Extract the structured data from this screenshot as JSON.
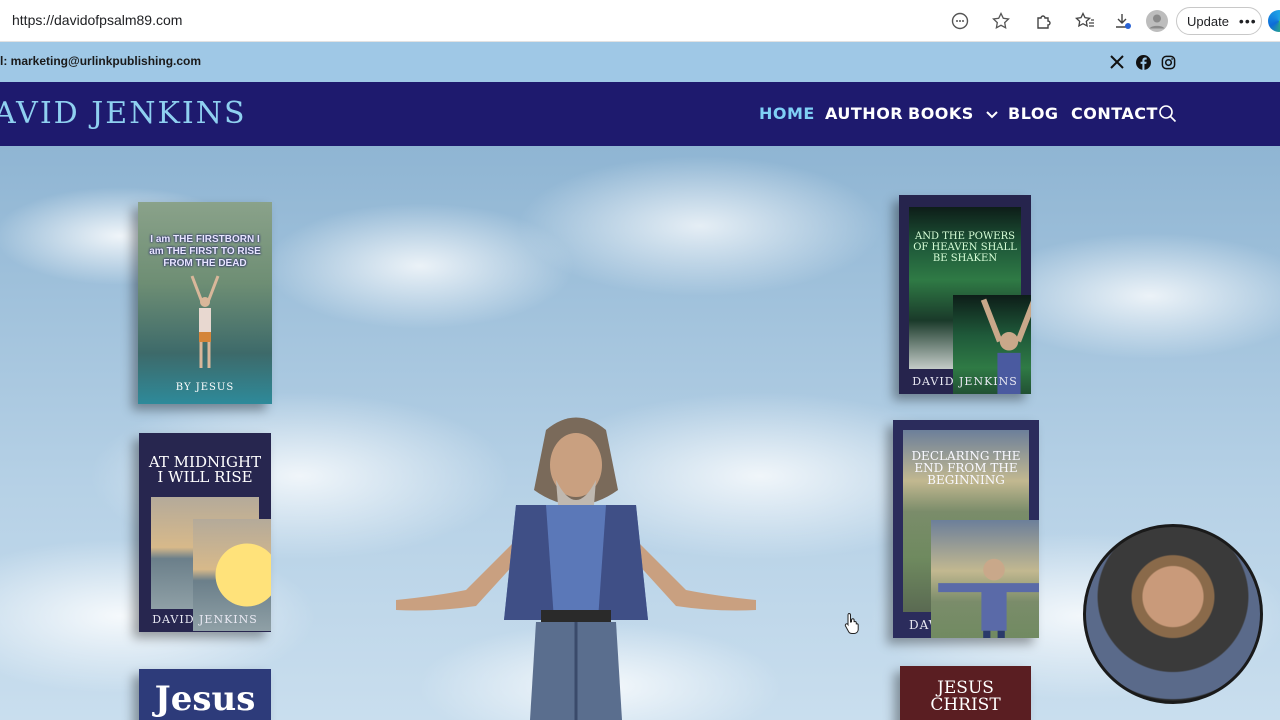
{
  "browser": {
    "url": "https://davidofpsalm89.com",
    "update_label": "Update",
    "more_label": "•••"
  },
  "topbar": {
    "email_text": "l: marketing@urlinkpublishing.com",
    "social_icons": [
      "x-icon",
      "facebook-icon",
      "instagram-icon"
    ]
  },
  "header": {
    "site_title": "AVID JENKINS",
    "nav": {
      "home": "HOME",
      "author": "AUTHOR",
      "books": "BOOKS",
      "blog": "BLOG",
      "contact": "CONTACT"
    },
    "colors": {
      "nav_bg": "#1e1a6e",
      "active": "#7fd0f5",
      "title": "#8fd0f0"
    }
  },
  "books": {
    "b1": {
      "title": "I am THE FIRSTBORN I am THE FIRST TO RISE FROM THE DEAD",
      "author": "BY JESUS"
    },
    "b2": {
      "title": "AT MIDNIGHT I WILL RISE",
      "author": "DAVID JENKINS"
    },
    "b3": {
      "title": "Jesus"
    },
    "b4": {
      "title": "AND THE POWERS OF HEAVEN SHALL BE SHAKEN",
      "author": "DAVID JENKINS"
    },
    "b5": {
      "title": "DECLARING THE END FROM THE BEGINNING",
      "author": "DAVID JENKINS"
    },
    "b6": {
      "title": "JESUS CHRIST"
    }
  }
}
